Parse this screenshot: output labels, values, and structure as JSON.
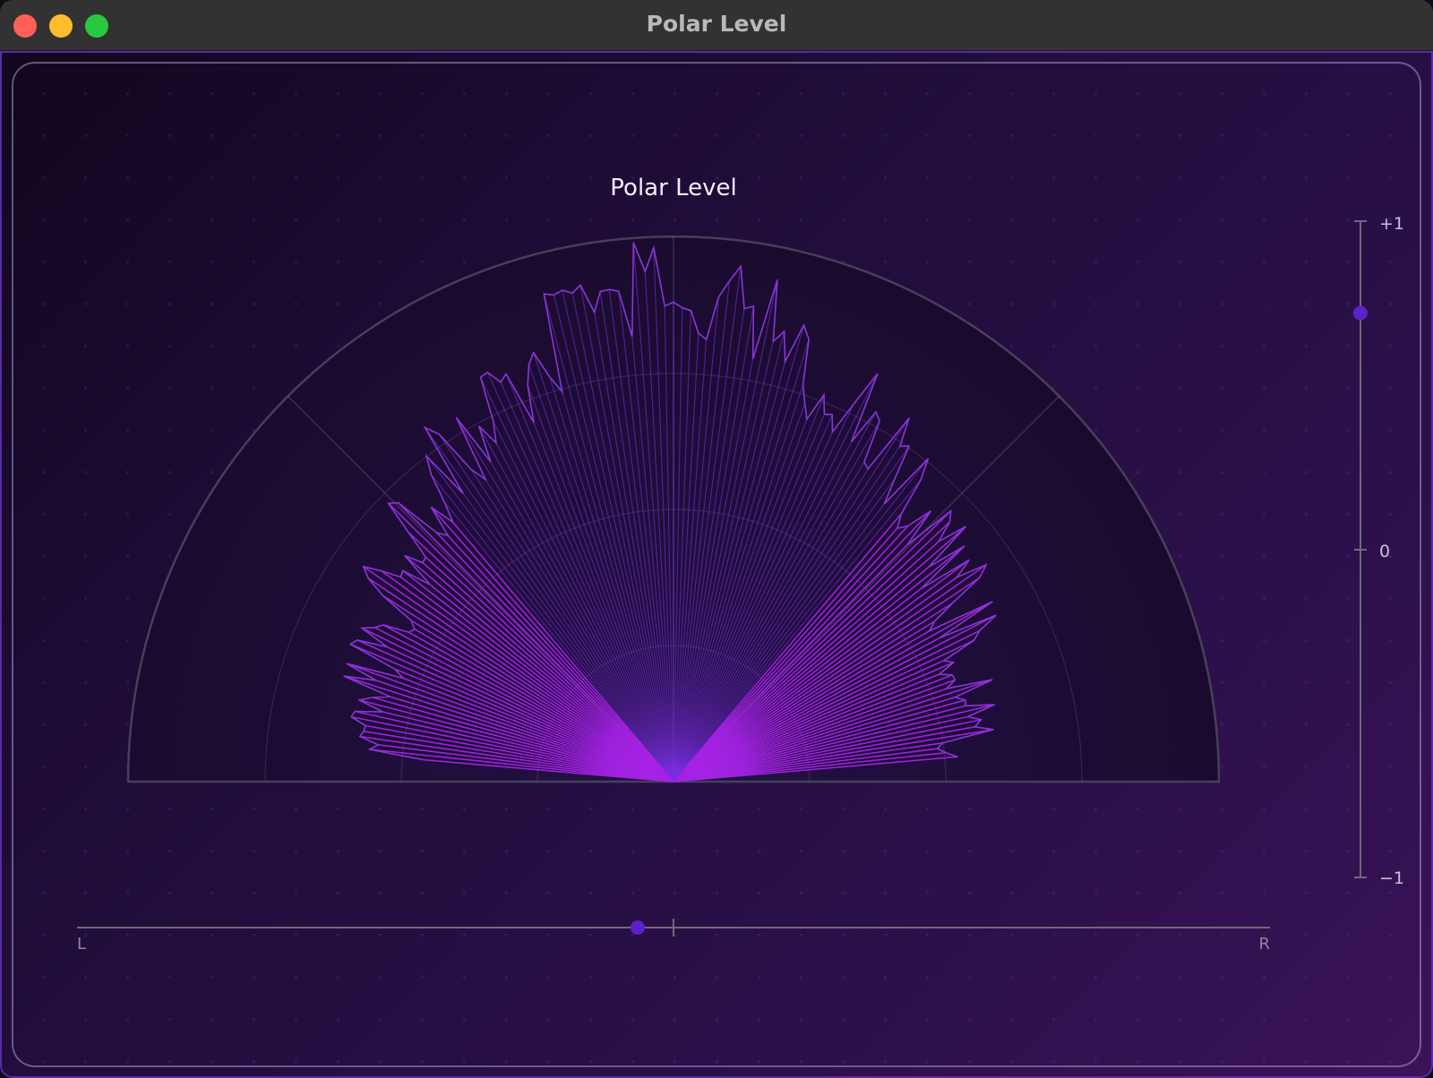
{
  "window": {
    "title": "Polar Level"
  },
  "meter": {
    "title": "Polar Level",
    "correlation": {
      "top_label": "+1",
      "mid_label": "0",
      "bottom_label": "−1",
      "value": 0.72
    },
    "balance": {
      "left_label": "L",
      "right_label": "R",
      "value": -0.06
    }
  },
  "colors": {
    "accent": "#7a2fe0",
    "trace": "#a523e6",
    "outline": "#8a36d6",
    "handle": "#5b22c9"
  }
}
